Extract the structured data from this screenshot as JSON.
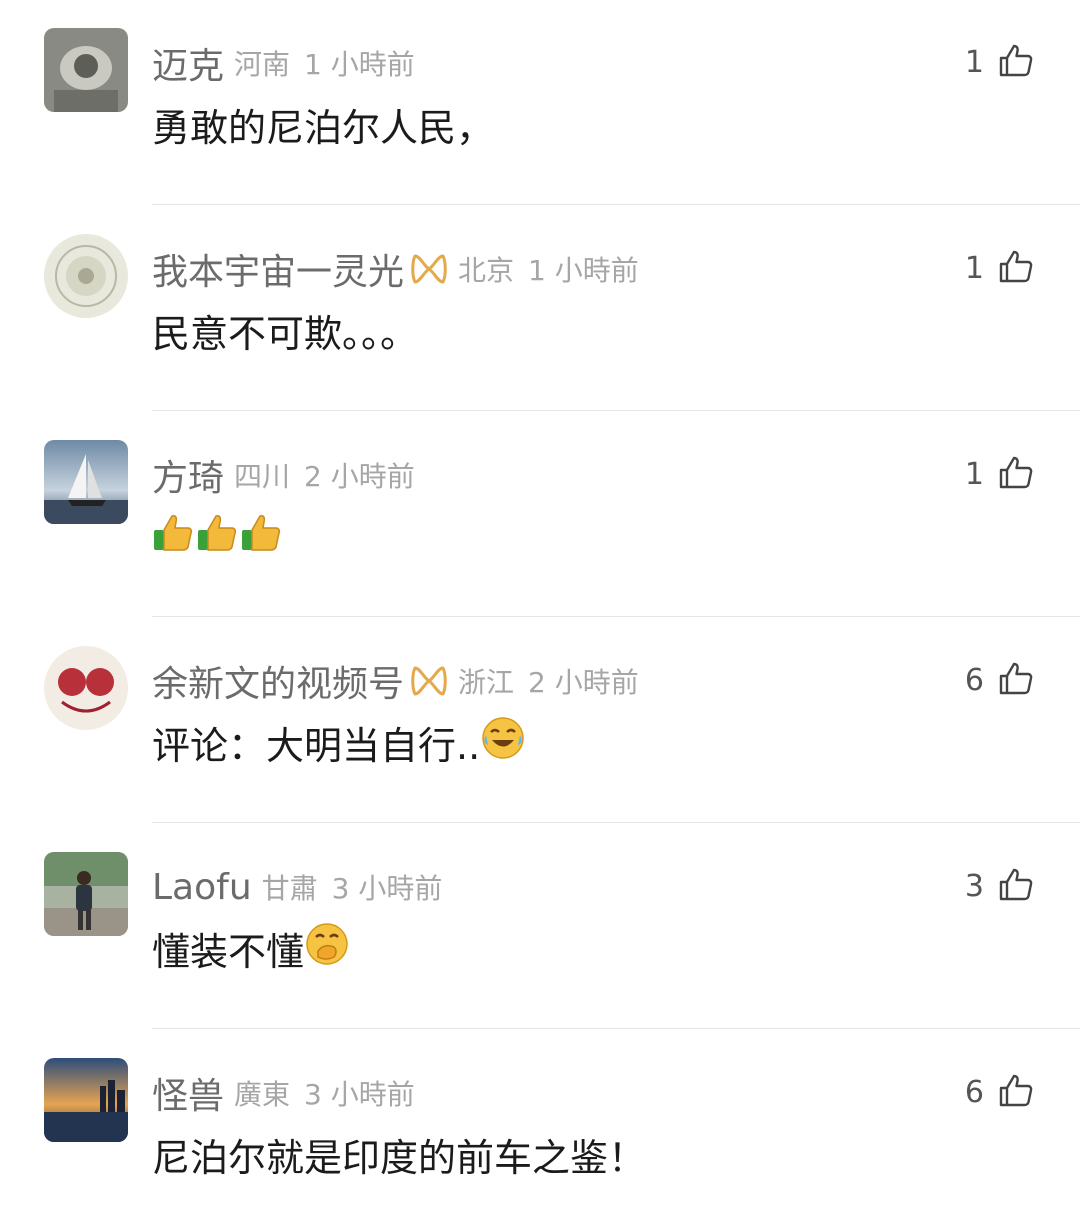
{
  "comments": [
    {
      "author": "迈克",
      "location": "河南",
      "time": "1 小時前",
      "likes": "1",
      "content": "勇敢的尼泊尔人民，",
      "verified": false
    },
    {
      "author": "我本宇宙一灵光",
      "location": "北京",
      "time": "1 小時前",
      "likes": "1",
      "content": "民意不可欺。。。",
      "verified": true
    },
    {
      "author": "方琦",
      "location": "四川",
      "time": "2 小時前",
      "likes": "1",
      "content": "",
      "emoji": "thumbs-up x3",
      "verified": false
    },
    {
      "author": "余新文的视频号",
      "location": "浙江",
      "time": "2 小時前",
      "likes": "6",
      "content": "评论：大明当自行..",
      "emoji": "laughing-crying",
      "verified": true
    },
    {
      "author": "Laofu",
      "location": "甘肅",
      "time": "3 小時前",
      "likes": "3",
      "content": "懂装不懂",
      "emoji": "hand-over-mouth",
      "verified": false
    },
    {
      "author": "怪兽",
      "location": "廣東",
      "time": "3 小時前",
      "likes": "6",
      "content": "尼泊尔就是印度的前车之鉴！",
      "verified": false
    }
  ],
  "colors": {
    "badge": "#e4a94b",
    "text": "#1b1b1b",
    "meta": "#a6a6a6"
  }
}
